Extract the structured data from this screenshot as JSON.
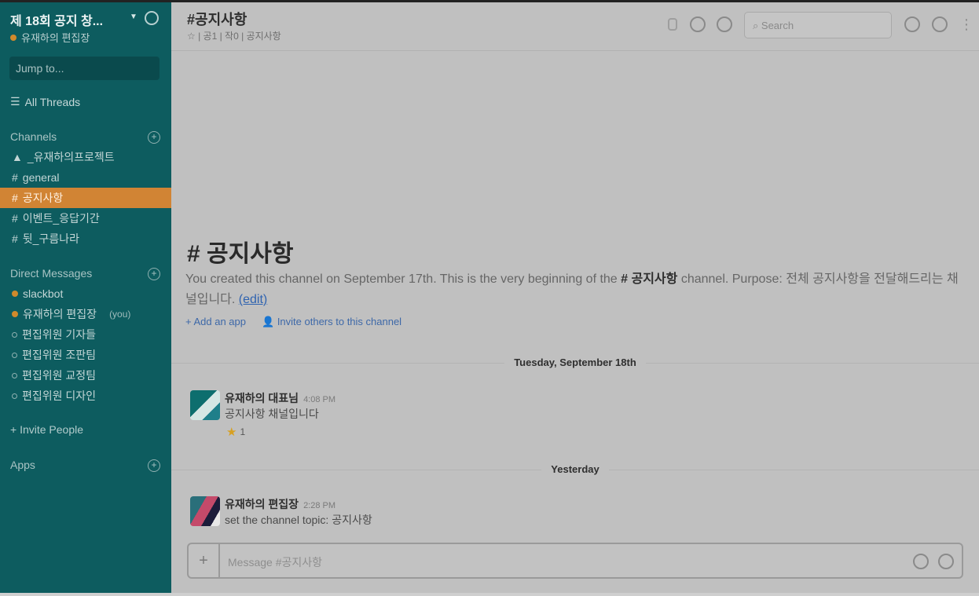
{
  "workspace": {
    "name": "제 18회 공지 창...",
    "user": "유재하의 편집장"
  },
  "sidebar": {
    "jump_placeholder": "Jump to...",
    "all_threads": "All Threads",
    "channels_title": "Channels",
    "channels": [
      {
        "label": "_유재하의프로젝트",
        "icon": "▲"
      },
      {
        "label": "general",
        "icon": "#"
      },
      {
        "label": "공지사항",
        "icon": "#",
        "active": true
      },
      {
        "label": "이벤트_응답기간",
        "icon": "#"
      },
      {
        "label": "뒷_구름나라",
        "icon": "#"
      }
    ],
    "dm_title": "Direct Messages",
    "dms": [
      {
        "label": "slackbot",
        "status": "online"
      },
      {
        "label": "유재하의 편집장",
        "status": "online",
        "suffix": "(you)"
      },
      {
        "label": "편집위원 기자들",
        "status": "away"
      },
      {
        "label": "편집위원 조판팀",
        "status": "away"
      },
      {
        "label": "편집위원 교정팀",
        "status": "away"
      },
      {
        "label": "편집위원 디자인",
        "status": "away"
      }
    ],
    "invite_label": "+ Invite People",
    "apps_title": "Apps"
  },
  "header": {
    "title": "#공지사항",
    "meta": "☆ | 공1 | 작0 | 공지사항",
    "search_placeholder": "Search",
    "kebab": "⋮"
  },
  "intro": {
    "title": "# 공지사항",
    "text_before": "You created this channel on September 17th. This is the very beginning of the ",
    "text_channel": "# 공지사항",
    "text_after": " channel. Purpose: 전체 공지사항을 전달해드리는 채널입니다. ",
    "edit_label": "(edit)",
    "add_app": "+ Add an app",
    "invite_others": "Invite others to this channel"
  },
  "day1": "Tuesday, September 18th",
  "day2": "Yesterday",
  "messages": [
    {
      "name": "유재하의 대표님",
      "time": "4:08 PM",
      "body": "공지사항 채널입니다",
      "reaction_count": "1"
    },
    {
      "name": "유재하의 편집장",
      "time": "2:28 PM",
      "body": "set the channel topic: 공지사항"
    }
  ],
  "composer": {
    "placeholder": "Message #공지사항",
    "plus": "+"
  }
}
